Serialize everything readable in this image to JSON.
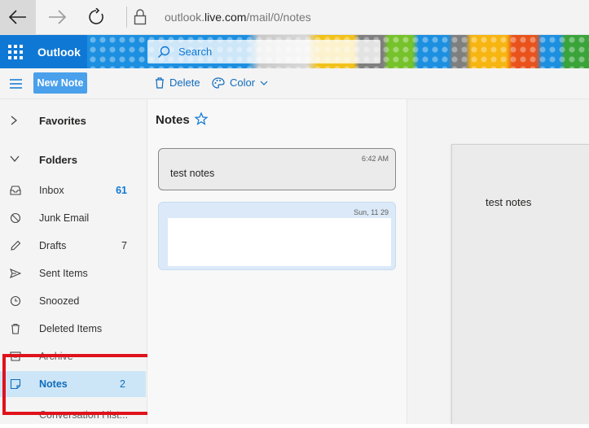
{
  "browser": {
    "url_prefix": "outlook.",
    "url_domain": "live.com",
    "url_path": "/mail/0/notes",
    "icons": [
      "back-arrow-icon",
      "forward-arrow-icon",
      "reload-icon",
      "lock-icon"
    ]
  },
  "header": {
    "app_name": "Outlook",
    "search_placeholder": "Search"
  },
  "toolbar": {
    "new_note_label": "New Note",
    "delete_label": "Delete",
    "color_label": "Color"
  },
  "sidebar": {
    "favorites_label": "Favorites",
    "folders_label": "Folders",
    "items": [
      {
        "label": "Inbox",
        "count": "61",
        "icon": "inbox-icon"
      },
      {
        "label": "Junk Email",
        "count": "",
        "icon": "block-icon"
      },
      {
        "label": "Drafts",
        "count": "7",
        "icon": "pencil-icon"
      },
      {
        "label": "Sent Items",
        "count": "",
        "icon": "send-icon"
      },
      {
        "label": "Snoozed",
        "count": "",
        "icon": "clock-icon"
      },
      {
        "label": "Deleted Items",
        "count": "",
        "icon": "trash-icon"
      },
      {
        "label": "Archive",
        "count": "",
        "icon": "archive-icon"
      },
      {
        "label": "Notes",
        "count": "2",
        "icon": "note-icon"
      },
      {
        "label": "Conversation Hist...",
        "count": "",
        "icon": "folder-icon"
      }
    ]
  },
  "notes_list": {
    "title": "Notes",
    "notes": [
      {
        "time": "6:42 AM",
        "text": "test notes"
      },
      {
        "time": "Sun, 11 29",
        "text": ""
      }
    ]
  },
  "reading_pane": {
    "content": "test notes"
  },
  "colors": {
    "accent": "#0f78d4",
    "selected_bg": "#cde6f7",
    "highlight_box": "#e0121b"
  }
}
